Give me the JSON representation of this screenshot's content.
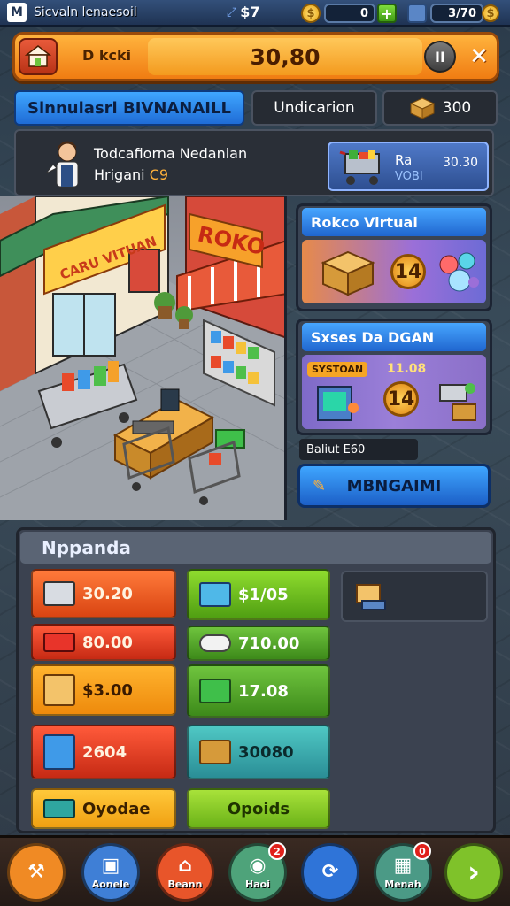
{
  "status_bar": {
    "logo_glyph": "M",
    "title": "Sicvaln lenaesoil",
    "money": "$7",
    "coin_count": "0",
    "right_value": "3/70",
    "coin_glyph": "$",
    "plus_glyph": "+"
  },
  "header": {
    "sub_label": "D kcki",
    "amount": "30,80",
    "pause_glyph": "II",
    "close_glyph": "✕"
  },
  "tabs": {
    "active": "Sinnulasri BIVNANAILL",
    "second": "Undicarion",
    "crate_count": "300"
  },
  "info": {
    "line1": "Todcafiorna Nedanian",
    "line2_prefix": "Hrigani",
    "line2_value": "C9",
    "cart_label1": "Ra",
    "cart_label2": "VOBI",
    "cart_price": "30.30"
  },
  "scene": {
    "sign_left": "CARU VITUAN",
    "sign_right": "ROKO"
  },
  "panels": {
    "top_title": "Rokco Virtual",
    "top_coin": "14",
    "mid_title": "Sxses Da DGAN",
    "mid_tag": "SYSTOAN",
    "mid_price": "11.08",
    "mid_coin": "14",
    "caption": "Baliut E60",
    "manage_label": "MBNGAIMI"
  },
  "market": {
    "title": "Nppanda",
    "items": [
      {
        "label": "30.20",
        "icon": "printer-icon",
        "color": "red"
      },
      {
        "label": "$1/05",
        "icon": "server-box-icon",
        "color": "green"
      },
      {
        "label": "80.00",
        "icon": "crate-icon",
        "color": "red2"
      },
      {
        "label": "710.00",
        "icon": "paper-roll-icon",
        "color": "green2"
      },
      {
        "label": "$3.00",
        "icon": "box-icon",
        "color": "orange"
      },
      {
        "label": "17.08",
        "icon": "cart-icon",
        "color": "green2"
      },
      {
        "label": "2604",
        "icon": "gift-icon",
        "color": "red2"
      },
      {
        "label": "30080",
        "icon": "package-icon",
        "color": "teal"
      },
      {
        "label": "Oyodae",
        "icon": "tray-icon",
        "color": "yellow"
      },
      {
        "label": "Opoids",
        "icon": "",
        "color": "lime"
      }
    ]
  },
  "nav": {
    "items": [
      {
        "label": "",
        "icon": "hammer-icon",
        "glyph": "⚒",
        "color": "#f08a24",
        "badge": ""
      },
      {
        "label": "Aonele",
        "icon": "tablet-icon",
        "glyph": "▣",
        "color": "#3f7fd6",
        "badge": ""
      },
      {
        "label": "Beann",
        "icon": "build-icon",
        "glyph": "⌂",
        "color": "#e8552a",
        "badge": ""
      },
      {
        "label": "Haoi",
        "icon": "disc-icon",
        "glyph": "◉",
        "color": "#4ea37a",
        "badge": "2"
      },
      {
        "label": "",
        "icon": "refresh-icon",
        "glyph": "⟳",
        "color": "#2f74d8",
        "badge": ""
      },
      {
        "label": "Menah",
        "icon": "keypad-icon",
        "glyph": "▦",
        "color": "#4b9a86",
        "badge": "0"
      },
      {
        "label": "",
        "icon": "next-arrow-icon",
        "glyph": "›",
        "color": "#7fc22a",
        "badge": ""
      }
    ]
  },
  "colors": {
    "accent_orange": "#f07c12",
    "accent_blue": "#1f6cd6",
    "panel_dark": "#2a2f37"
  }
}
